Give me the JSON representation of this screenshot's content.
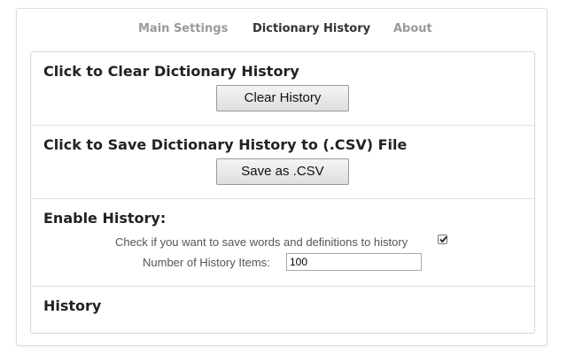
{
  "tabs": [
    {
      "label": "Main Settings",
      "active": false
    },
    {
      "label": "Dictionary History",
      "active": true
    },
    {
      "label": "About",
      "active": false
    }
  ],
  "clear_section": {
    "heading": "Click to Clear Dictionary History",
    "button_label": "Clear History"
  },
  "save_section": {
    "heading": "Click to Save Dictionary History to (.CSV) File",
    "button_label": "Save as .CSV"
  },
  "enable_section": {
    "heading": "Enable History:",
    "checkbox_label": "Check if you want to save words and definitions to history",
    "checkbox_checked": true,
    "items_label": "Number of History Items:",
    "items_value": "100"
  },
  "history_section": {
    "heading": "History"
  },
  "colors": {
    "active_tab": "#333333",
    "inactive_tab": "#9a9a9a",
    "border": "#d6d6d6"
  }
}
